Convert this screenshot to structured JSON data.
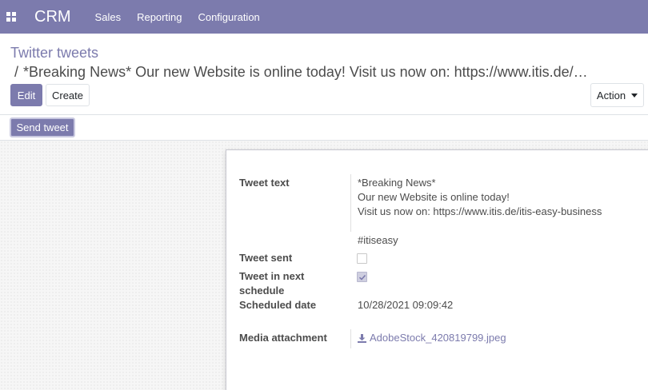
{
  "navbar": {
    "brand": "CRM",
    "menu": [
      "Sales",
      "Reporting",
      "Configuration"
    ]
  },
  "breadcrumb": {
    "parent": "Twitter tweets",
    "separator": "/",
    "current": "*Breaking News* Our new Website is online today! Visit us now on: https://www.itis.de/itis-easy-business"
  },
  "buttons": {
    "edit": "Edit",
    "create": "Create",
    "action": "Action",
    "send_tweet": "Send tweet"
  },
  "form": {
    "tweet_text_label": "Tweet text",
    "tweet_text": "*Breaking News*\nOur new Website is online today!\nVisit us now on:  https://www.itis.de/itis-easy-business\n\n#itiseasy",
    "tweet_sent_label": "Tweet sent",
    "tweet_sent": false,
    "tweet_next_label": "Tweet in next schedule",
    "tweet_next": true,
    "scheduled_date_label": "Scheduled date",
    "scheduled_date": "10/28/2021 09:09:42",
    "media_label": "Media attachment",
    "media_file": "AdobeStock_420819799.jpeg"
  },
  "colors": {
    "brand": "#7c7bad",
    "text": "#4c4c4c"
  }
}
